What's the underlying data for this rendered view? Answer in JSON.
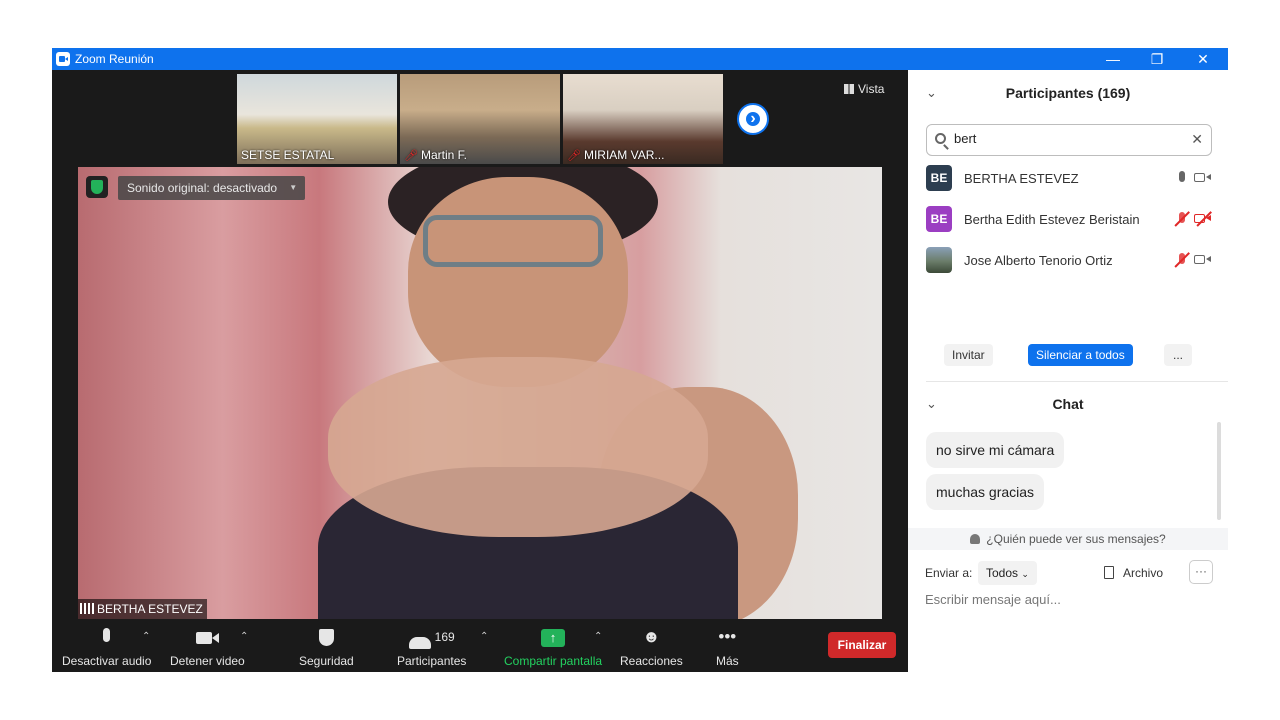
{
  "window": {
    "title": "Zoom Reunión"
  },
  "stage": {
    "thumbnails": [
      {
        "name": "SETSE ESTATAL",
        "muted": false
      },
      {
        "name": "Martin F.",
        "muted": true
      },
      {
        "name": "MIRIAM VAR...",
        "muted": true
      }
    ],
    "view_label": "Vista",
    "original_sound": "Sonido original: desactivado",
    "active_speaker": "BERTHA ESTEVEZ"
  },
  "toolbar": {
    "mute_audio": "Desactivar audio",
    "stop_video": "Detener video",
    "security": "Seguridad",
    "participants": "Participantes",
    "participant_count": "169",
    "share_screen": "Compartir pantalla",
    "reactions": "Reacciones",
    "more": "Más",
    "end": "Finalizar"
  },
  "participants_panel": {
    "title": "Participantes (169)",
    "search_value": "bert",
    "list": [
      {
        "initials": "BE",
        "name": "BERTHA ESTEVEZ",
        "avatar_color": "#2d3e50",
        "mic_muted": false,
        "video_off": false
      },
      {
        "initials": "BE",
        "name": "Bertha Edith Estevez Beristain",
        "avatar_color": "#9b3ec2",
        "mic_muted": true,
        "video_off": true
      },
      {
        "initials": "",
        "name": "Jose Alberto Tenorio Ortiz",
        "avatar_color": "#5a6b4a",
        "mic_muted": true,
        "video_off": false
      }
    ],
    "invite": "Invitar",
    "mute_all": "Silenciar a todos",
    "more": "..."
  },
  "chat_panel": {
    "title": "Chat",
    "messages": [
      "no sirve mi cámara",
      "muchas gracias"
    ],
    "who_can_see": "¿Quién puede ver sus mensajes?",
    "send_to_label": "Enviar a:",
    "send_to_value": "Todos",
    "file": "Archivo",
    "more": "···",
    "input_placeholder": "Escribir mensaje aquí..."
  }
}
